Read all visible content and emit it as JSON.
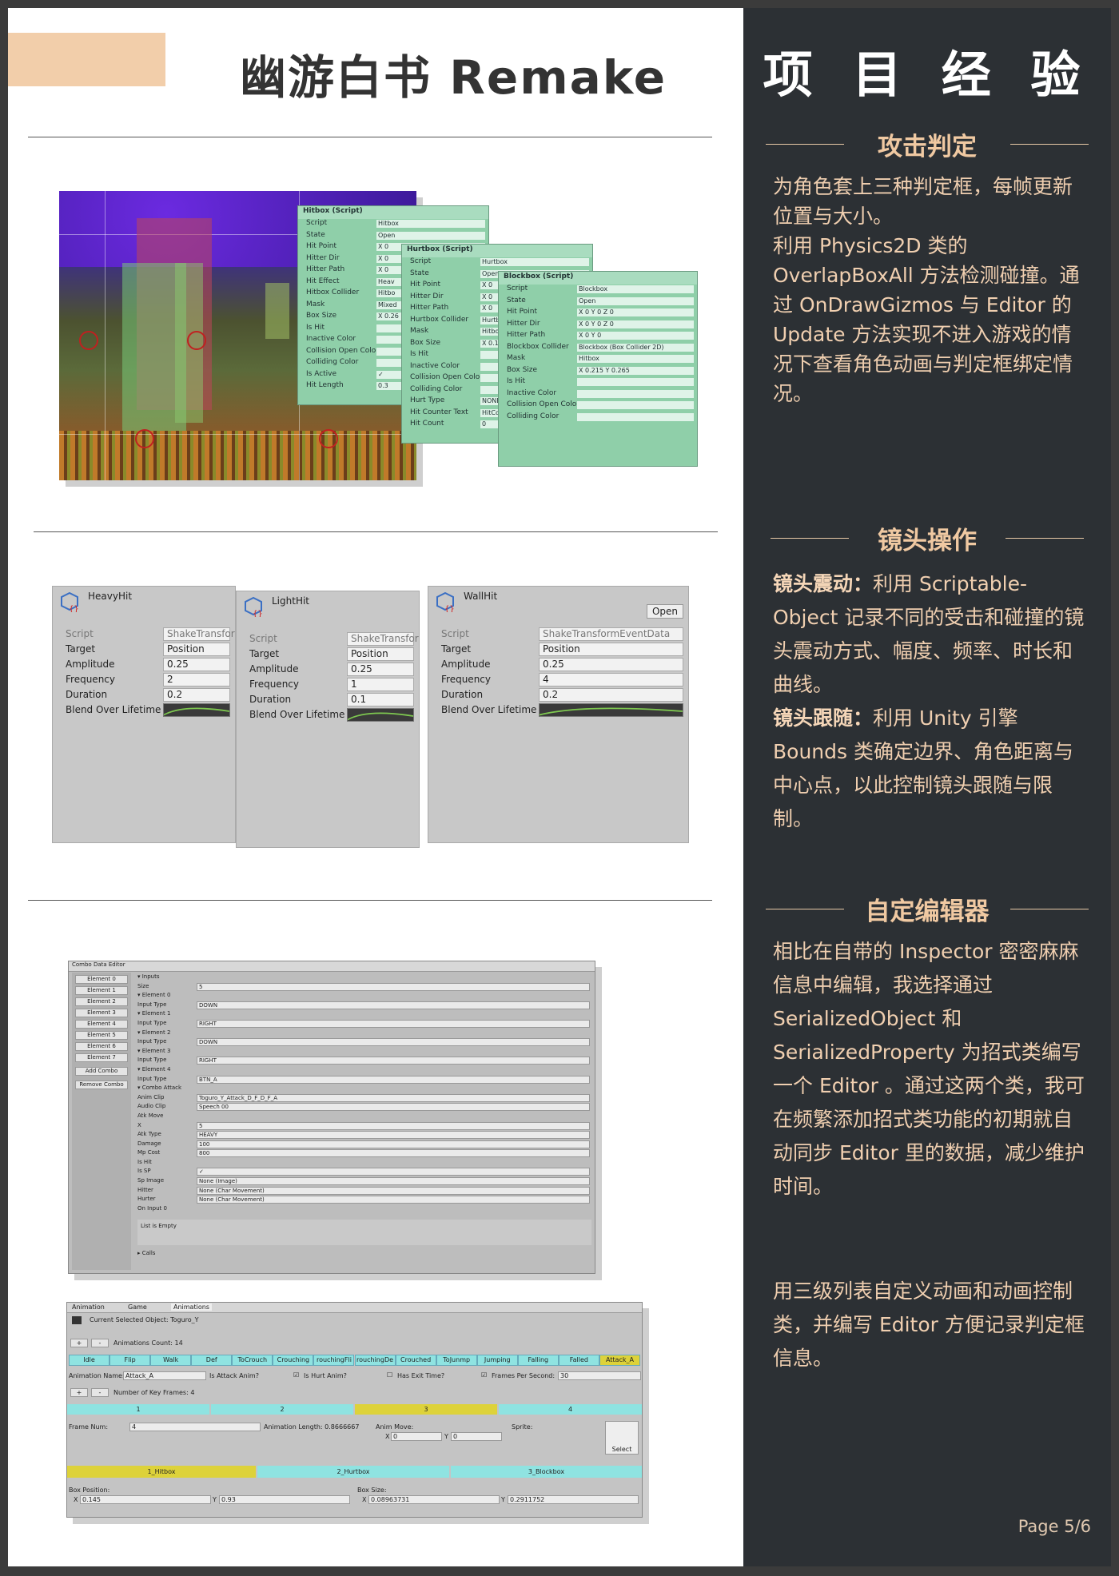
{
  "left": {
    "title": "幽游白书 Remake"
  },
  "right": {
    "title": "项 目 经 验",
    "sections": [
      {
        "heading": "攻击判定",
        "paragraphs": [
          "为角色套上三种判定框，每帧更新位置与大小。",
          "利用 Physics2D 类的 OverlapBoxAll 方法检测碰撞。通过 OnDrawGizmos 与 Editor 的 Update 方法实现不进入游戏的情况下查看角色动画与判定框绑定情况。"
        ]
      },
      {
        "heading": "镜头操作",
        "items": [
          {
            "label": "镜头震动：",
            "text": "利用 Scriptable-Object 记录不同的受击和碰撞的镜头震动方式、幅度、频率、时长和曲线。"
          },
          {
            "label": "镜头跟随：",
            "text": "利用 Unity 引擎 Bounds 类确定边界、角色距离与中心点，以此控制镜头跟随与限制。"
          }
        ]
      },
      {
        "heading": "自定编辑器",
        "paragraphs": [
          "相比在自带的 Inspector 密密麻麻信息中编辑，我选择通过 SerializedObject 和 SerializedProperty 为招式类编写一个 Editor 。通过这两个类，我可在频繁添加招式类功能的初期就自动同步 Editor 里的数据，减少维护时间。",
          "用三级列表自定义动画和动画控制类，并编写 Editor 方便记录判定框信息。"
        ]
      }
    ],
    "page": "Page 5/6"
  },
  "hitbox_panels": [
    {
      "title": "Hitbox (Script)",
      "rows": [
        [
          "Script",
          "Hitbox"
        ],
        [
          "State",
          "Open"
        ],
        [
          "Hit Point",
          "X 0"
        ],
        [
          "Hitter Dir",
          "X 0"
        ],
        [
          "Hitter Path",
          "X 0"
        ],
        [
          "Hit Effect",
          "Heav"
        ],
        [
          "Hitbox Collider",
          "Hitbo"
        ],
        [
          "Mask",
          "Mixed"
        ],
        [
          "Box Size",
          "X 0.26"
        ],
        [
          "Is Hit",
          ""
        ],
        [
          "Inactive Color",
          ""
        ],
        [
          "Collision Open Color",
          ""
        ],
        [
          "Colliding Color",
          ""
        ],
        [
          "Is Active",
          "✓"
        ],
        [
          "Hit Length",
          "0.3"
        ]
      ]
    },
    {
      "title": "Hurtbox (Script)",
      "rows": [
        [
          "Script",
          "Hurtbox"
        ],
        [
          "State",
          "Open"
        ],
        [
          "Hit Point",
          "X 0"
        ],
        [
          "Hitter Dir",
          "X 0"
        ],
        [
          "Hitter Path",
          "X 0"
        ],
        [
          "Hurtbox Collider",
          "Hurtb"
        ],
        [
          "Mask",
          "Hitbox"
        ],
        [
          "Box Size",
          "X 0.175"
        ],
        [
          "Is Hit",
          ""
        ],
        [
          "Inactive Color",
          ""
        ],
        [
          "Collision Open Color",
          ""
        ],
        [
          "Colliding Color",
          ""
        ],
        [
          "Hurt Type",
          "NONE"
        ],
        [
          "Hit Counter Text",
          "HitCo"
        ],
        [
          "Hit Count",
          "0"
        ]
      ]
    },
    {
      "title": "Blockbox (Script)",
      "rows": [
        [
          "Script",
          "Blockbox"
        ],
        [
          "State",
          "Open"
        ],
        [
          "Hit Point",
          "X 0   Y 0   Z 0"
        ],
        [
          "Hitter Dir",
          "X 0   Y 0   Z 0"
        ],
        [
          "Hitter Path",
          "X 0   Y 0"
        ],
        [
          "Blockbox Collider",
          "Blockbox (Box Collider 2D)"
        ],
        [
          "Mask",
          "Hitbox"
        ],
        [
          "Box Size",
          "X 0.215   Y 0.265"
        ],
        [
          "Is Hit",
          ""
        ],
        [
          "Inactive Color",
          ""
        ],
        [
          "Collision Open Color",
          ""
        ],
        [
          "Colliding Color",
          ""
        ]
      ]
    }
  ],
  "shake_inspectors": [
    {
      "name": "HeavyHit",
      "script": "ShakeTransfor",
      "target": "Position",
      "amplitude": "0.25",
      "frequency": "2",
      "duration": "0.2"
    },
    {
      "name": "LightHit",
      "script": "ShakeTransfor",
      "target": "Position",
      "amplitude": "0.25",
      "frequency": "1",
      "duration": "0.1"
    },
    {
      "name": "WallHit",
      "script": "ShakeTransformEventData",
      "target": "Position",
      "amplitude": "0.25",
      "frequency": "4",
      "duration": "0.2",
      "open": "Open"
    }
  ],
  "shake_labels": {
    "script": "Script",
    "target": "Target",
    "amplitude": "Amplitude",
    "frequency": "Frequency",
    "duration": "Duration",
    "blend": "Blend Over Lifetime"
  },
  "combo_editor": {
    "title": "Combo Data Editor",
    "elements": [
      "Element 0",
      "Element 1",
      "Element 2",
      "Element 3",
      "Element 4",
      "Element 5",
      "Element 6",
      "Element 7"
    ],
    "add": "Add Combo",
    "remove": "Remove Combo",
    "rows": [
      [
        "▾ Inputs",
        ""
      ],
      [
        "Size",
        "5"
      ],
      [
        "▾ Element 0",
        ""
      ],
      [
        "Input Type",
        "DOWN"
      ],
      [
        "▾ Element 1",
        ""
      ],
      [
        "Input Type",
        "RIGHT"
      ],
      [
        "▾ Element 2",
        ""
      ],
      [
        "Input Type",
        "DOWN"
      ],
      [
        "▾ Element 3",
        ""
      ],
      [
        "Input Type",
        "RIGHT"
      ],
      [
        "▾ Element 4",
        ""
      ],
      [
        "Input Type",
        "BTN_A"
      ],
      [
        "▾ Combo Attack",
        ""
      ],
      [
        "Anim Clip",
        "Toguro_Y_Attack_D_F_D_F_A"
      ],
      [
        "Audio Clip",
        "Speech 00"
      ],
      [
        "Atk Move",
        ""
      ],
      [
        "X",
        "5"
      ],
      [
        "Atk Type",
        "HEAVY"
      ],
      [
        "Damage",
        "100"
      ],
      [
        "Mp Cost",
        "800"
      ],
      [
        "Is Hit",
        ""
      ],
      [
        "Is SP",
        "✓"
      ],
      [
        "Sp Image",
        "None (Image)"
      ],
      [
        "Hitter",
        "None (Char Movement)"
      ],
      [
        "Hurter",
        "None (Char Movement)"
      ],
      [
        "On Input 0",
        ""
      ]
    ],
    "empty": "List is Empty",
    "calls": "▸ Calls"
  },
  "anim_editor": {
    "tabs": [
      "Animation",
      "Game",
      "Animations"
    ],
    "selected": "Current Selected Object: Toguro_Y",
    "count": "Animations Count: 14",
    "clips": [
      "Idle",
      "Flip",
      "Walk",
      "Def",
      "ToCrouch",
      "Crouching",
      "rouchingFli",
      "rouchingDe",
      "Crouched",
      "ToJunmp",
      "Jumping",
      "Falling",
      "Falled",
      "Attack_A"
    ],
    "name_label": "Animation Name:",
    "name_value": "Attack_A",
    "is_attack": "Is Attack Anim?",
    "is_hurt": "Is Hurt Anim?",
    "has_exit": "Has Exit Time?",
    "fps_label": "Frames Per Second:",
    "fps_value": "30",
    "key_frames": "Number of Key Frames: 4",
    "frames": [
      "1",
      "2",
      "3",
      "4"
    ],
    "frame_num_label": "Frame Num:",
    "frame_num": "4",
    "anim_length": "Animation Length: 0.8666667",
    "anim_move": "Anim Move:",
    "sprite": "Sprite:",
    "select": "Select",
    "boxes": [
      "1_Hitbox",
      "2_Hurtbox",
      "3_Blockbox"
    ],
    "box_pos": "Box Position:",
    "box_size": "Box Size:",
    "pos_x": "0.145",
    "pos_y": "0.93",
    "size_x": "0.08963731",
    "size_y": "0.2911752"
  }
}
